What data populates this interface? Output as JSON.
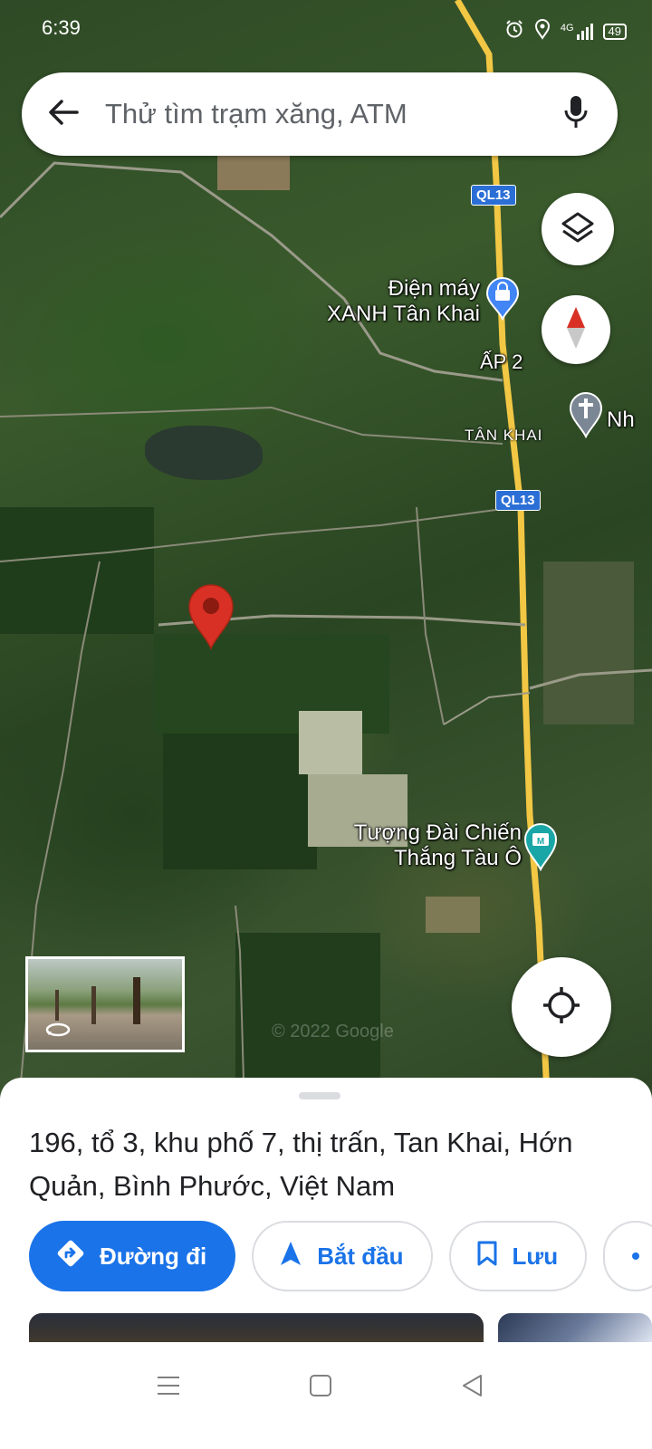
{
  "status_bar": {
    "time": "6:39",
    "network": "4G",
    "battery": "49"
  },
  "search": {
    "placeholder": "Thử tìm trạm xăng, ATM"
  },
  "map": {
    "labels": {
      "poi_dien_may": "Điện máy\nXANH Tân Khai",
      "ap2": "ẤP 2",
      "tan_khai": "TÂN KHAI",
      "nh": "Nh",
      "tuong_dai": "Tượng Đài Chiến\nThắng Tàu Ô",
      "watermark": "© 2022 Google"
    },
    "road_shields": [
      "QL13",
      "QL13"
    ]
  },
  "place": {
    "address": "196, tổ 3, khu phố 7, thị trấn, Tan Khai, Hớn Quản, Bình Phước, Việt Nam"
  },
  "actions": {
    "directions": "Đường đi",
    "start": "Bắt đầu",
    "save": "Lưu"
  },
  "colors": {
    "accent": "#1a73e8",
    "pin_red": "#d93025",
    "road_yellow": "#f2c744"
  },
  "icons": {
    "back": "arrow-left-icon",
    "mic": "microphone-icon",
    "layers": "layers-icon",
    "compass": "compass-icon",
    "location": "my-location-icon",
    "directions": "directions-diamond-icon",
    "start": "navigation-arrow-icon",
    "save": "bookmark-icon"
  }
}
